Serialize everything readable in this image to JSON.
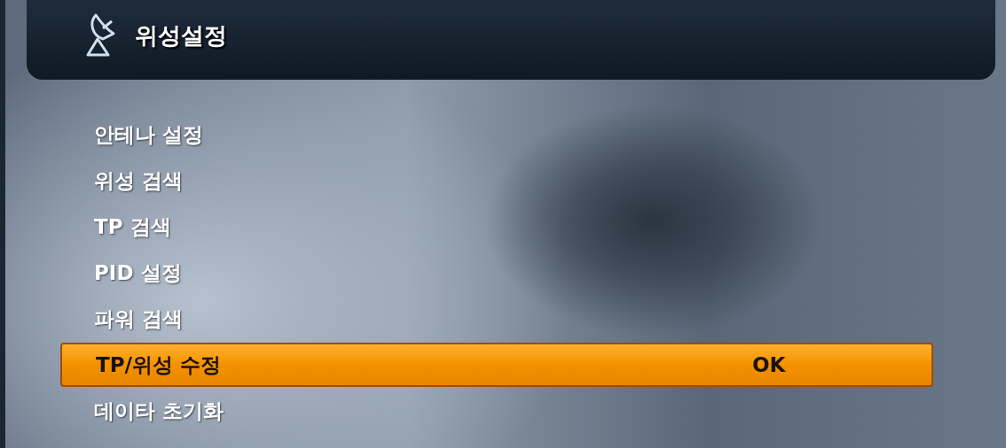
{
  "header": {
    "title": "위성설정"
  },
  "menu": [
    {
      "label": "안테나 설정",
      "selected": false
    },
    {
      "label": "위성 검색",
      "selected": false
    },
    {
      "label": "TP 검색",
      "selected": false
    },
    {
      "label": "PID 설정",
      "selected": false
    },
    {
      "label": "파워 검색",
      "selected": false
    },
    {
      "label": "TP/위성 수정",
      "selected": true,
      "hint": "OK"
    },
    {
      "label": "데이타 초기화",
      "selected": false
    }
  ]
}
